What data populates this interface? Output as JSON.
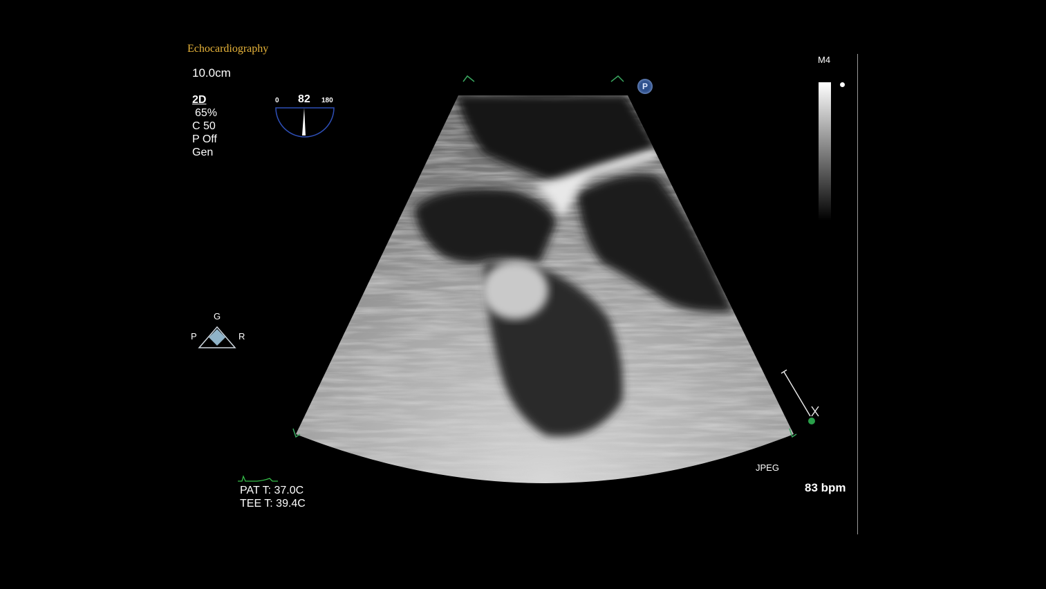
{
  "header": {
    "title": "Echocardiography"
  },
  "settings": {
    "depth": "10.0cm",
    "mode": "2D",
    "gain": "65%",
    "compress": "C 50",
    "power": "P Off",
    "freq": "Gen"
  },
  "angle": {
    "min": "0",
    "value": "82",
    "max": "180"
  },
  "orientation": {
    "top": "G",
    "left": "P",
    "right": "R"
  },
  "probe": {
    "label": "M4",
    "badge": "P"
  },
  "temps": {
    "patient": "PAT T: 37.0C",
    "tee": "TEE T: 39.4C"
  },
  "format": "JPEG",
  "heart_rate": "83 bpm",
  "colors": {
    "title": "#e8b43a",
    "angle_arc": "#2e4fb8",
    "marker_dot": "#2aa04a",
    "ecg_trace": "#36c04a"
  },
  "icons": [
    "probe-angle-icon",
    "orientation-icon",
    "ecg-trace-icon",
    "depth-marker-icon",
    "probe-badge-icon"
  ]
}
